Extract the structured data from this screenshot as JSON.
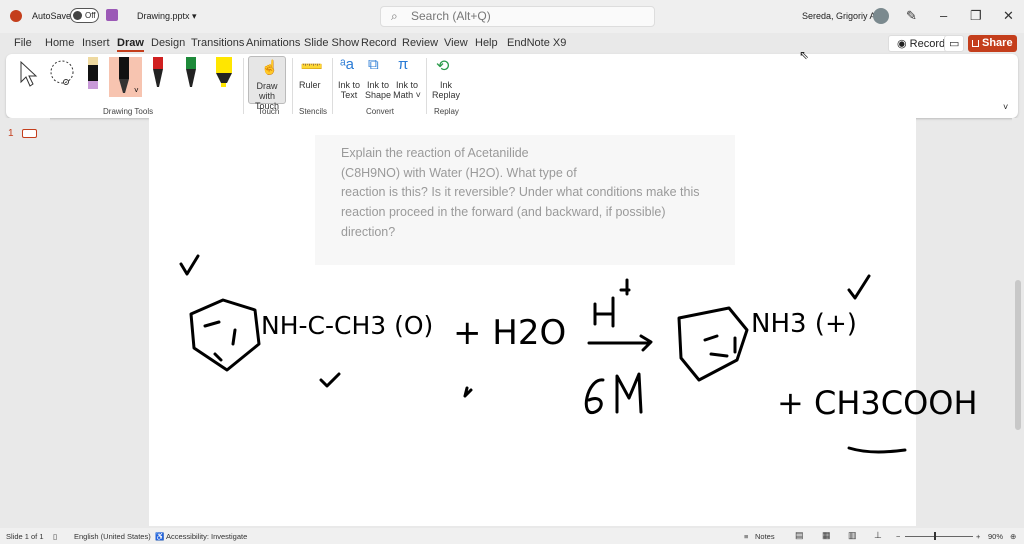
{
  "titlebar": {
    "autosave": "AutoSave",
    "autosave_state": "Off",
    "filename": "Drawing.pptx ▾",
    "search_placeholder": "Search (Alt+Q)",
    "user": "Sereda, Grigoriy A"
  },
  "tabs": [
    "File",
    "Home",
    "Insert",
    "Draw",
    "Design",
    "Transitions",
    "Animations",
    "Slide Show",
    "Record",
    "Review",
    "View",
    "Help",
    "EndNote X9"
  ],
  "active_tab": "Draw",
  "actions": {
    "record": "Record",
    "share": "Share"
  },
  "ribbon": {
    "draw_with_touch": "Draw with Touch",
    "ruler": "Ruler",
    "ink_to_text": "Ink to Text",
    "ink_to_shape": "Ink to Shape",
    "ink_to_math": "Ink to Math ˅",
    "ink_replay": "Ink Replay",
    "groups": {
      "drawing_tools": "Drawing Tools",
      "touch": "Touch",
      "stencils": "Stencils",
      "convert": "Convert",
      "replay": "Replay"
    }
  },
  "thumbs": {
    "slide_number": "1"
  },
  "slide": {
    "question": "Explain the reaction of Acetanilide\n(C8H9NO) with Water (H2O). What type of\nreaction is this? Is it reversible? Under what conditions make this\nreaction proceed in the forward (and backward, if possible)\ndirection?",
    "ink": [
      "NH-C-CH3 (O)",
      "+ H2O",
      "H+",
      "6M",
      "NH3 (+)",
      "+ CH3COOH"
    ]
  },
  "status": {
    "slide": "Slide 1 of 1",
    "language": "English (United States)",
    "accessibility": "Accessibility: Investigate",
    "notes": "Notes",
    "zoom": "90%"
  },
  "colors": {
    "accent": "#c43e1c"
  }
}
